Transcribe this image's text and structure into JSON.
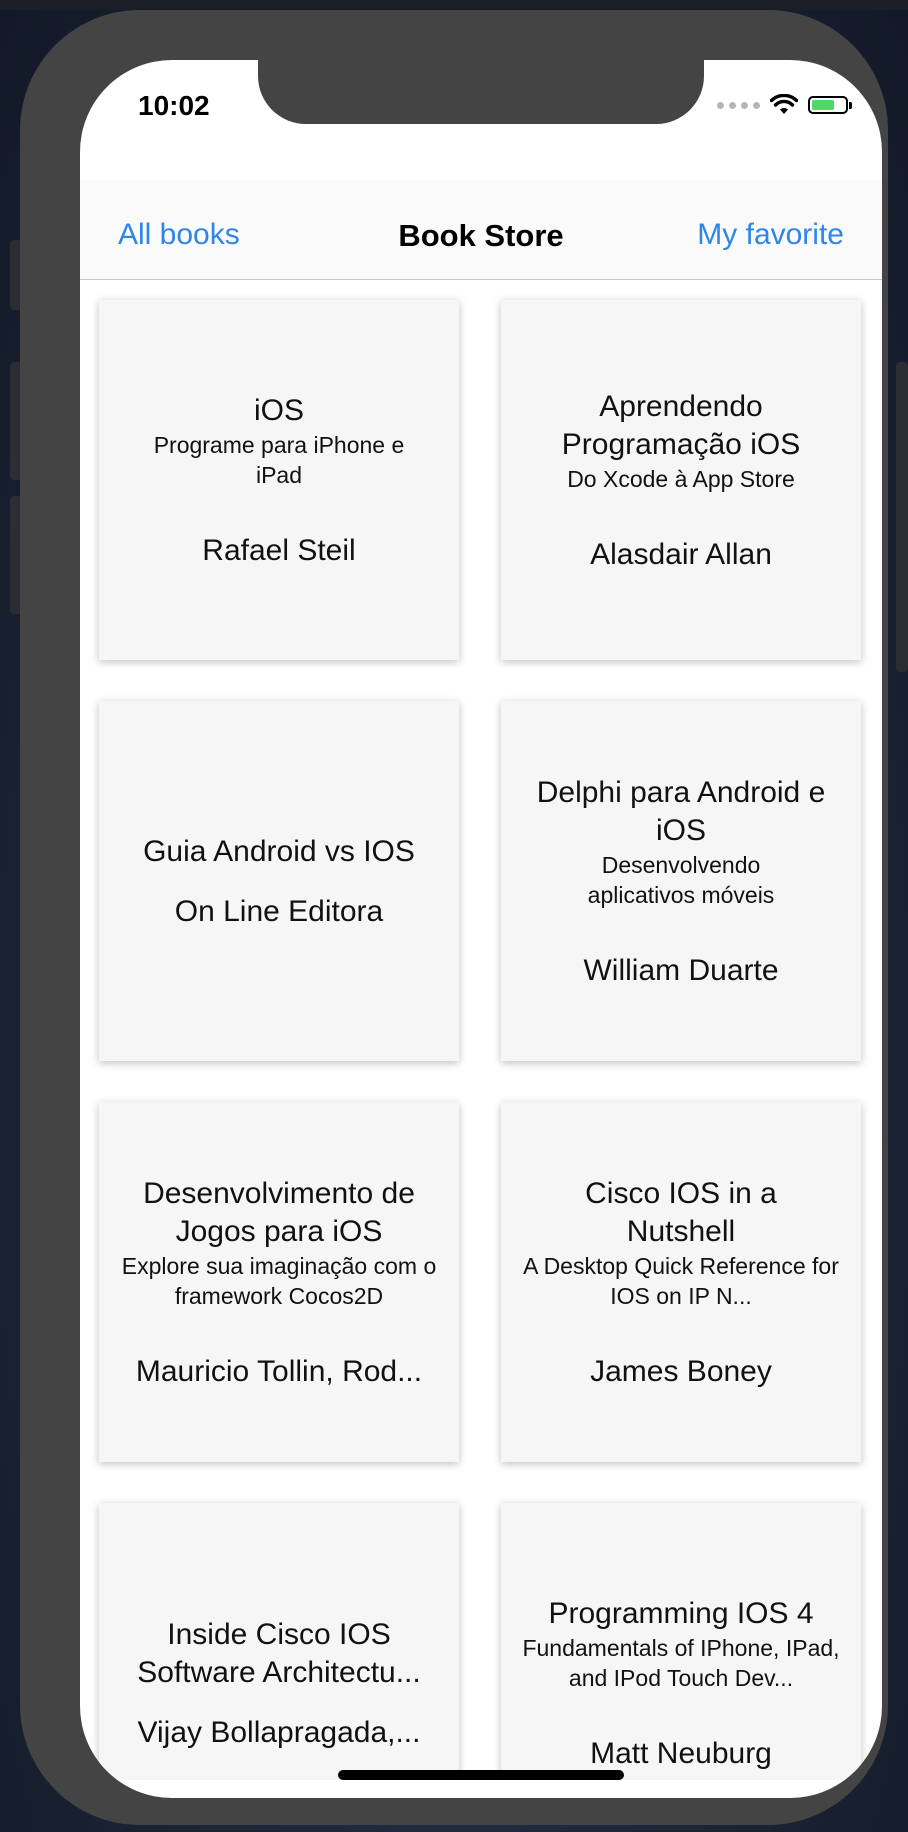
{
  "status_bar": {
    "time": "10:02"
  },
  "nav": {
    "left_label": "All books",
    "title": "Book Store",
    "right_label": "My favorite"
  },
  "books": [
    {
      "title": "iOS",
      "subtitle": "Programe para iPhone e iPad",
      "author": "Rafael Steil"
    },
    {
      "title": "Aprendendo Programação iOS",
      "subtitle": "Do Xcode à App Store",
      "author": "Alasdair Allan"
    },
    {
      "title": "Guia Android vs IOS",
      "subtitle": "",
      "author": "On Line Editora"
    },
    {
      "title": "Delphi para Android e iOS",
      "subtitle": "Desenvolvendo aplicativos móveis",
      "author": "William Duarte"
    },
    {
      "title": "Desenvolvimento de Jogos para iOS",
      "subtitle": "Explore sua imaginação com o framework Cocos2D",
      "author": "Mauricio Tollin, Rod..."
    },
    {
      "title": "Cisco IOS in a Nutshell",
      "subtitle": "A Desktop Quick Reference for IOS on IP N...",
      "author": "James Boney"
    },
    {
      "title": "Inside Cisco IOS Software Architectu...",
      "subtitle": "",
      "author": "Vijay Bollapragada,..."
    },
    {
      "title": "Programming IOS 4",
      "subtitle": "Fundamentals of IPhone, IPad, and IPod Touch Dev...",
      "author": "Matt Neuburg"
    }
  ]
}
